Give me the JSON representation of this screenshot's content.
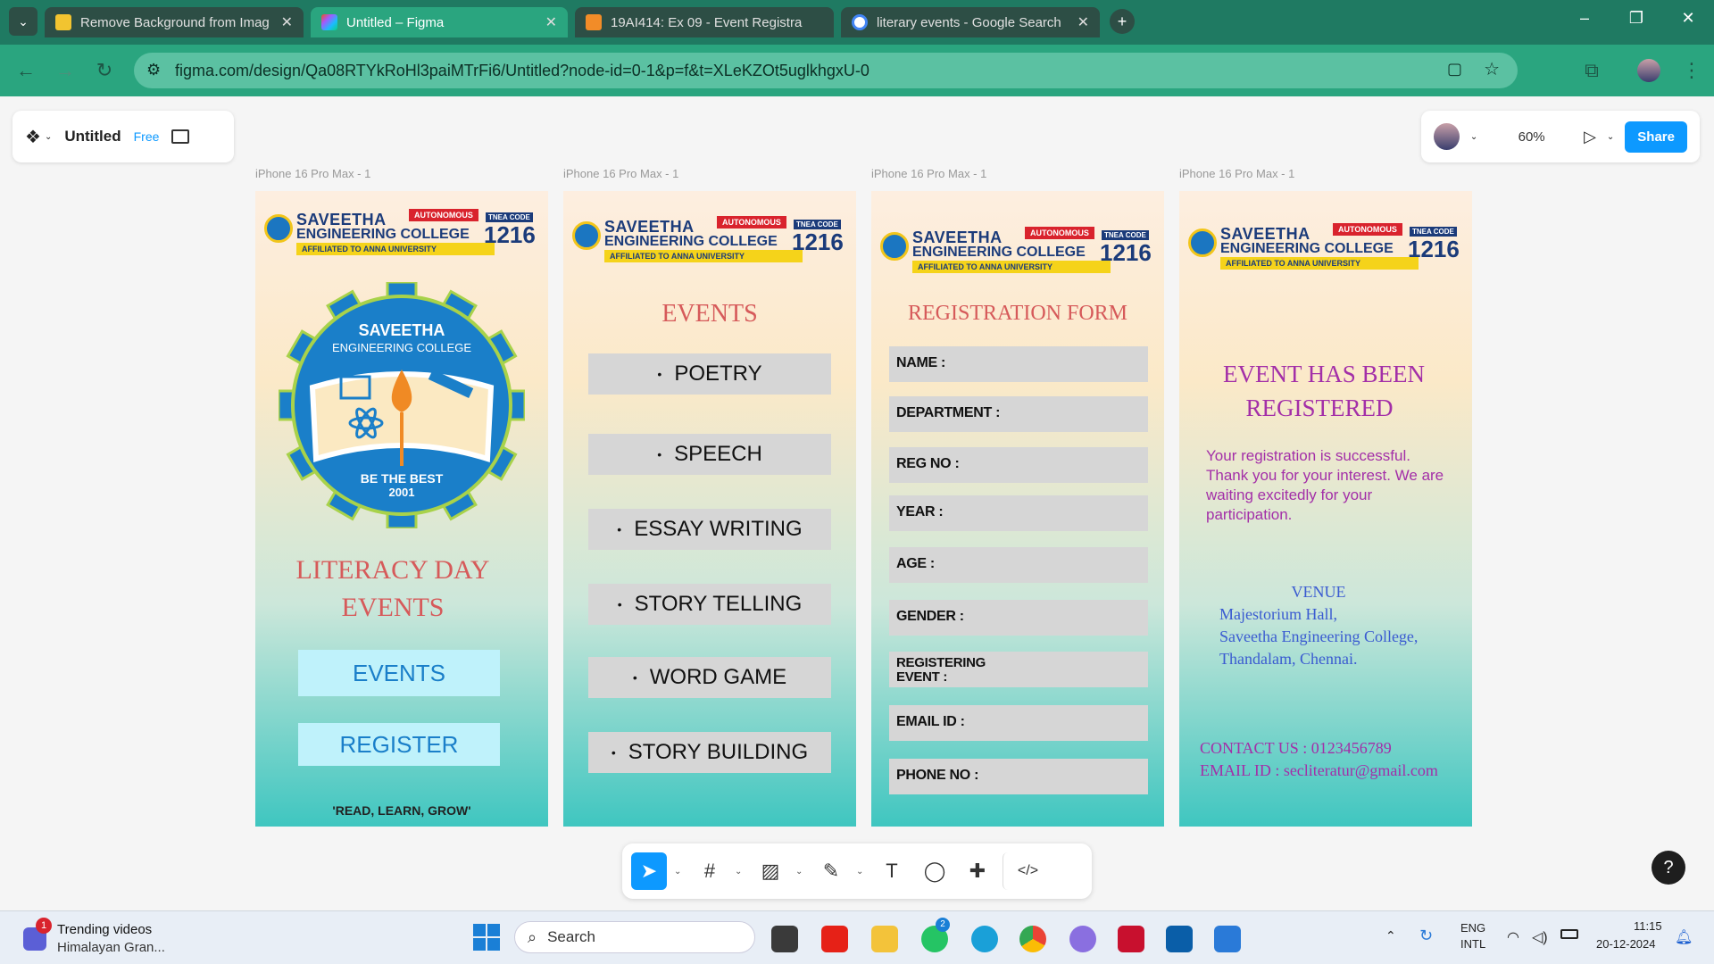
{
  "tabs": [
    {
      "title": "Remove Background from Imag",
      "active": false
    },
    {
      "title": "Untitled – Figma",
      "active": true
    },
    {
      "title": "19AI414: Ex 09 - Event Registra",
      "active": false
    },
    {
      "title": "literary events - Google Search",
      "active": false
    }
  ],
  "url": "figma.com/design/Qa08RTYkRoHl3paiMTrFi6/Untitled?node-id=0-1&p=f&t=XLeKZOt5uglkhgxU-0",
  "figma": {
    "file_name": "Untitled",
    "plan": "Free",
    "zoom": "60%",
    "share": "Share"
  },
  "frame_label": "iPhone 16 Pro Max - 1",
  "college": {
    "name1": "SAVEETHA",
    "name2": "ENGINEERING COLLEGE",
    "autonomous": "AUTONOMOUS",
    "affiliated": "AFFILIATED TO ANNA UNIVERSITY",
    "tnea": "TNEA CODE",
    "code": "1216"
  },
  "frame1": {
    "logo_title": "SAVEETHA",
    "logo_sub": "ENGINEERING COLLEGE",
    "logo_motto": "BE THE BEST",
    "logo_year": "2001",
    "title_line1": "LITERACY DAY",
    "title_line2": "EVENTS",
    "btn_events": "EVENTS",
    "btn_register": "REGISTER",
    "tagline": "'READ, LEARN, GROW'"
  },
  "frame2": {
    "title": "EVENTS",
    "items": [
      "POETRY",
      "SPEECH",
      "ESSAY WRITING",
      "STORY TELLING",
      "WORD GAME",
      "STORY BUILDING"
    ]
  },
  "frame3": {
    "title": "REGISTRATION FORM",
    "fields": [
      "NAME :",
      "DEPARTMENT :",
      "REG NO :",
      "YEAR :",
      "AGE :",
      "GENDER :",
      "REGISTERING\nEVENT :",
      "EMAIL ID :",
      "PHONE NO :"
    ]
  },
  "frame4": {
    "title_line1": "EVENT HAS BEEN",
    "title_line2": "REGISTERED",
    "message": "Your registration is successful. Thank you for your interest.  We are waiting excitedly for your participation.",
    "venue_label": "VENUE",
    "venue_line1": "Majestorium Hall,",
    "venue_line2": "Saveetha Engineering College,",
    "venue_line3": "Thandalam, Chennai.",
    "contact": "CONTACT US : 0123456789",
    "email": "EMAIL ID : secliteratur@gmail.com"
  },
  "taskbar": {
    "widget_title": "Trending videos",
    "widget_sub": "Himalayan Gran...",
    "widget_badge": "1",
    "search": "Search",
    "whatsapp_badge": "2",
    "lang1": "ENG",
    "lang2": "INTL",
    "time": "11:15",
    "date": "20-12-2024"
  },
  "help": "?"
}
